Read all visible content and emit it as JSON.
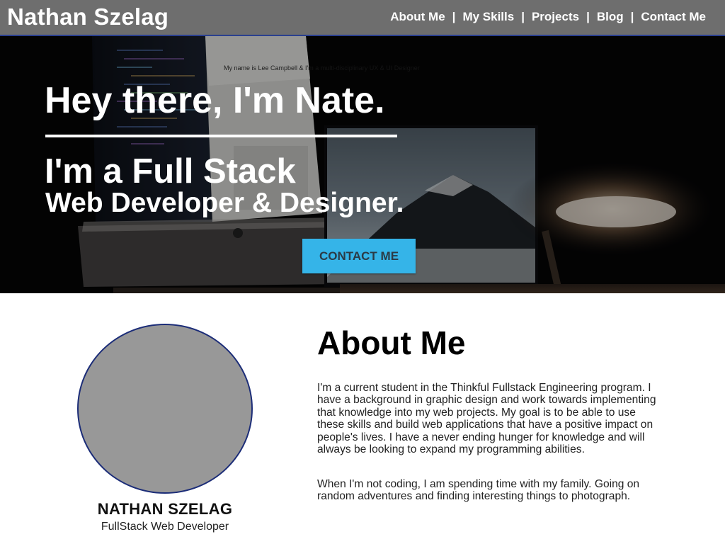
{
  "header": {
    "site_name": "Nathan Szelag",
    "nav": [
      {
        "label": "About Me"
      },
      {
        "label": "My Skills"
      },
      {
        "label": "Projects"
      },
      {
        "label": "Blog"
      },
      {
        "label": "Contact Me"
      }
    ],
    "separator": "|"
  },
  "hero": {
    "title": "Hey there, I'm Nate.",
    "line1": "I'm a Full Stack",
    "line2": "Web Developer & Designer.",
    "contact_button": "CONTACT ME",
    "photo_text": "My name is Lee Campbell & I'm a multi-disciplinary UX & UI Designer"
  },
  "profile": {
    "name": "NATHAN SZELAG",
    "role": "FullStack Web Developer"
  },
  "about": {
    "title": "About Me",
    "paragraphs": [
      "I'm a current student in the Thinkful Fullstack Engineering program. I have a background in graphic design and work towards implementing that knowledge into my web projects. My goal is to be able to use these skills and build web applications that have a positive impact on people's lives. I have a never ending hunger for knowledge and will always be looking to expand my programming abilities.",
      "When I'm not coding, I am spending time with my family. Going on random adventures and finding interesting things to photograph."
    ]
  },
  "colors": {
    "header_bg": "#6e6e6e",
    "header_border": "#2a3f8f",
    "button_bg": "#35b4e8",
    "avatar_fill": "#989898",
    "avatar_border": "#1c2d78"
  }
}
